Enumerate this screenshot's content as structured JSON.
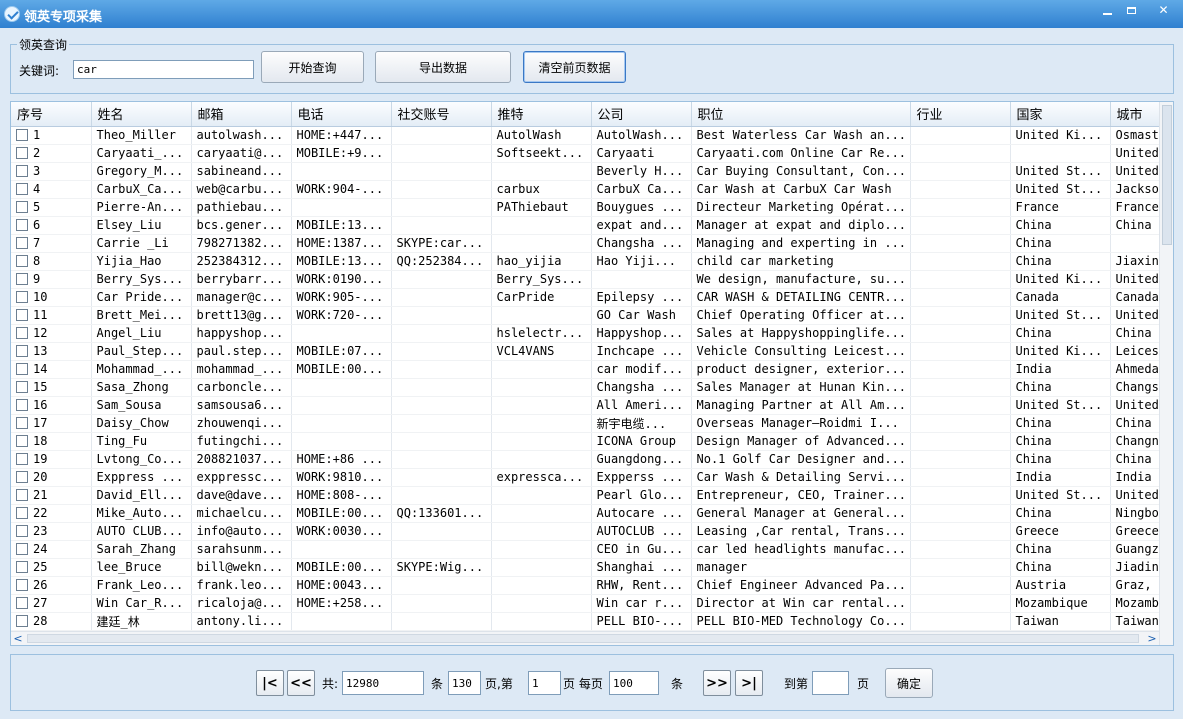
{
  "window": {
    "title": "领英专项采集",
    "logo_icon": "app-logo-icon"
  },
  "query": {
    "legend": "领英查询",
    "keyword_label": "关键词:",
    "keyword_value": "car",
    "start_button": "开始查询",
    "export_button": "导出数据",
    "clear_button": "清空前页数据"
  },
  "table": {
    "columns": [
      "序号",
      "姓名",
      "邮箱",
      "电话",
      "社交账号",
      "推特",
      "公司",
      "职位",
      "行业",
      "国家",
      "城市"
    ],
    "rows": [
      [
        "1",
        "Theo_Miller",
        "autolwash...",
        "HOME:+447...",
        "",
        "AutolWash",
        "AutolWash...",
        "Best Waterless Car Wash an...",
        "",
        "United Ki...",
        "Osmast"
      ],
      [
        "2",
        "Caryaati_...",
        "caryaati@...",
        "MOBILE:+9...",
        "",
        "Softseekt...",
        "Caryaati",
        "Caryaati.com Online Car Re...",
        "",
        "",
        "United"
      ],
      [
        "3",
        "Gregory_M...",
        "sabineand...",
        "",
        "",
        "",
        "Beverly H...",
        "Car Buying Consultant, Con...",
        "",
        "United St...",
        "United"
      ],
      [
        "4",
        "CarbuX_Ca...",
        "web@carbu...",
        "WORK:904-...",
        "",
        "carbux",
        "CarbuX Ca...",
        "Car Wash at CarbuX Car Wash",
        "",
        "United St...",
        "Jackso"
      ],
      [
        "5",
        "Pierre-An...",
        "pathiebau...",
        "",
        "",
        "PAThiebaut",
        "Bouygues ...",
        "Directeur Marketing Opérat...",
        "",
        "France",
        "France"
      ],
      [
        "6",
        "Elsey_Liu",
        "bcs.gener...",
        "MOBILE:13...",
        "",
        "",
        "expat and...",
        "Manager at expat and diplo...",
        "",
        "China",
        "China"
      ],
      [
        "7",
        "Carrie _Li",
        "798271382...",
        "HOME:1387...",
        "SKYPE:car...",
        "",
        "Changsha ...",
        "Managing and experting in ...",
        "",
        "China",
        ""
      ],
      [
        "8",
        "Yijia_Hao",
        "252384312...",
        "MOBILE:13...",
        "QQ:252384...",
        "hao_yijia",
        "Hao  Yiji...",
        "child car marketing",
        "",
        "China",
        "Jiaxin"
      ],
      [
        "9",
        "Berry_Sys...",
        "berrybarr...",
        "WORK:0190...",
        "",
        "Berry_Sys...",
        "",
        "We design, manufacture, su...",
        "",
        "United Ki...",
        "United"
      ],
      [
        "10",
        "Car Pride...",
        "manager@c...",
        "WORK:905-...",
        "",
        "CarPride",
        "Epilepsy ...",
        "CAR WASH & DETAILING CENTR...",
        "",
        "Canada",
        "Canada"
      ],
      [
        "11",
        "Brett_Mei...",
        "brett13@g...",
        "WORK:720-...",
        "",
        "",
        "GO Car Wash",
        "Chief Operating Officer at...",
        "",
        "United St...",
        "United"
      ],
      [
        "12",
        "Angel_Liu",
        "happyshop...",
        "",
        "",
        "hslelectr...",
        "Happyshop...",
        "Sales at Happyshoppinglife...",
        "",
        "China",
        "China"
      ],
      [
        "13",
        "Paul_Step...",
        "paul.step...",
        "MOBILE:07...",
        "",
        "VCL4VANS",
        "Inchcape ...",
        "Vehicle Consulting Leicest...",
        "",
        "United Ki...",
        "Leices"
      ],
      [
        "14",
        "Mohammad_...",
        "mohammad_...",
        "MOBILE:00...",
        "",
        "",
        "car modif...",
        "product designer, exterior...",
        "",
        "India",
        "Ahmeda"
      ],
      [
        "15",
        "Sasa_Zhong",
        "carboncle...",
        "",
        "",
        "",
        "Changsha ...",
        "Sales Manager at Hunan Kin...",
        "",
        "China",
        "Changs"
      ],
      [
        "16",
        "Sam_Sousa",
        "samsousa6...",
        "",
        "",
        "",
        "All Ameri...",
        "Managing Partner at All Am...",
        "",
        "United St...",
        "United"
      ],
      [
        "17",
        "Daisy_Chow",
        "zhouwenqi...",
        "",
        "",
        "",
        "新宇电缆...",
        "Overseas Manager—Roidmi I...",
        "",
        "China",
        "China"
      ],
      [
        "18",
        "Ting_Fu",
        "futingchi...",
        "",
        "",
        "",
        "ICONA Group",
        "Design Manager of Advanced...",
        "",
        "China",
        "Changn"
      ],
      [
        "19",
        "Lvtong_Co...",
        "208821037...",
        "HOME:+86 ...",
        "",
        "",
        "Guangdong...",
        "No.1 Golf Car Designer and...",
        "",
        "China",
        "China"
      ],
      [
        "20",
        "Exppress ...",
        "exppressc...",
        "WORK:9810...",
        "",
        "expressca...",
        "Expperss ...",
        "Car Wash & Detailing Servi...",
        "",
        "India",
        "India"
      ],
      [
        "21",
        "David_Ell...",
        "dave@dave...",
        "HOME:808-...",
        "",
        "",
        "Pearl Glo...",
        "Entrepreneur, CEO, Trainer...",
        "",
        "United St...",
        "United"
      ],
      [
        "22",
        "Mike_Auto...",
        "michaelcu...",
        "MOBILE:00...",
        "QQ:133601...",
        "",
        "Autocare ...",
        "General Manager at General...",
        "",
        "China",
        "Ningbo"
      ],
      [
        "23",
        "AUTO CLUB...",
        "info@auto...",
        "WORK:0030...",
        "",
        "",
        "AUTOCLUB ...",
        "Leasing ,Car rental, Trans...",
        "",
        "Greece",
        "Greece"
      ],
      [
        "24",
        "Sarah_Zhang",
        "sarahsunm...",
        "",
        "",
        "",
        "CEO in Gu...",
        "car led headlights manufac...",
        "",
        "China",
        "Guangz"
      ],
      [
        "25",
        "lee_Bruce",
        "bill@wekn...",
        "MOBILE:00...",
        "SKYPE:Wig...",
        "",
        "Shanghai ...",
        "manager",
        "",
        "China",
        "Jiadin"
      ],
      [
        "26",
        "Frank_Leo...",
        "frank.leo...",
        "HOME:0043...",
        "",
        "",
        "RHW, Rent...",
        "Chief Engineer Advanced Pa...",
        "",
        "Austria",
        "Graz,"
      ],
      [
        "27",
        "Win Car_R...",
        "ricaloja@...",
        "HOME:+258...",
        "",
        "",
        "Win car r...",
        "Director at Win car rental...",
        "",
        "Mozambique",
        "Mozamb"
      ],
      [
        "28",
        "建廷_林",
        "antony.li...",
        "",
        "",
        "",
        "PELL BIO-...",
        "PELL BIO-MED Technology Co...",
        "",
        "Taiwan",
        "Taiwan"
      ]
    ]
  },
  "pager": {
    "first_label": "|<",
    "prev_label": "<<",
    "next_label": ">>",
    "last_label": ">|",
    "total_prefix": "共:",
    "total_records": "12980",
    "records_unit": "条",
    "total_pages": "130",
    "pages_unit_current": "页,第",
    "current_page": "1",
    "per_page_label": "页 每页",
    "per_page": "100",
    "per_page_unit": "条",
    "goto_label": "到第",
    "goto_value": "",
    "goto_unit": "页",
    "goto_button": "确定"
  }
}
